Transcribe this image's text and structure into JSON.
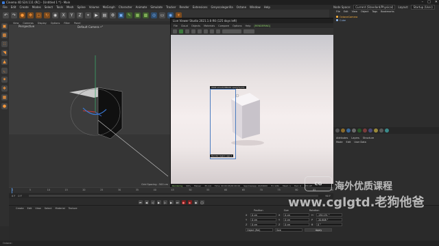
{
  "window": {
    "title": "Cinema 4D S24.111 (RC) - [Untitled 1 *] - Main",
    "min_icon": "minimize-icon",
    "max_icon": "maximize-icon",
    "close_icon": "close-icon"
  },
  "menubar": [
    "File",
    "Edit",
    "Create",
    "Modes",
    "Select",
    "Tools",
    "Mesh",
    "Spline",
    "Volume",
    "MoGraph",
    "Character",
    "Animate",
    "Simulate",
    "Tracker",
    "Render",
    "Extensions",
    "Greyscalegorilla",
    "Octane",
    "Window",
    "Help"
  ],
  "rightbar": {
    "node_space_label": "Node Space:",
    "node_space_value": "Current (Standard/Physical)",
    "layout_label": "Layout:",
    "layout_value": "Startup (User)"
  },
  "viewport": {
    "menu": [
      "View",
      "Cameras",
      "Display",
      "Options",
      "Filter",
      "Panel"
    ],
    "name": "Perspective",
    "camera": "Default Camera •°",
    "grid_spacing": "Grid Spacing : 500 cm"
  },
  "ipr": {
    "title": "Live Viewer Studio 2021.1.6-R6 (125 days left)",
    "menu": [
      "File",
      "Cloud",
      "Objects",
      "Materials",
      "Compare",
      "Options",
      "Help",
      "[RENDERING]"
    ],
    "region_label": "WKM smart/CBRAW spent/%(23)",
    "region_render": "Render region spp:1",
    "status": [
      "Rendering",
      "99%",
      "Ms/sec",
      "35.1/4",
      "Time: 00:00:05/00:00:06",
      "Spp/maxspp: 20/16000",
      "Tri: 0/6k",
      "Mesh: 1",
      "Hair: 0",
      "RTX:off"
    ]
  },
  "object_manager": {
    "tabs": [
      "File",
      "Edit",
      "View",
      "Object",
      "Tags",
      "Bookmarks"
    ],
    "objects": [
      {
        "name": "OctaneCamera",
        "color": "#ffb23a"
      },
      {
        "name": "Cube",
        "color": "#8fb6e8"
      }
    ]
  },
  "attributes": {
    "tabs": [
      "Attributes",
      "Layers",
      "Structure"
    ],
    "menu": [
      "Mode",
      "Edit",
      "User Data"
    ]
  },
  "timeline": {
    "ticks": [
      "0",
      "5",
      "10",
      "15",
      "20",
      "25",
      "30",
      "35",
      "40",
      "45",
      "50",
      "55",
      "60",
      "65",
      "70",
      "75",
      "80",
      "85",
      "90"
    ],
    "start": "0 F",
    "end": "90 F",
    "current": "0 F"
  },
  "material_manager": {
    "menu": [
      "Create",
      "Edit",
      "View",
      "Select",
      "Material",
      "Texture"
    ]
  },
  "coordinates": {
    "headers": [
      "Position",
      "Size",
      "Rotation"
    ],
    "rows": [
      {
        "axis": "X",
        "pos": "0 cm",
        "size": "0 cm",
        "rot_label": "H",
        "rot": "-130.151 °"
      },
      {
        "axis": "Y",
        "pos": "0 cm",
        "size": "0 cm",
        "rot_label": "P",
        "rot": "-20.608 °"
      },
      {
        "axis": "Z",
        "pos": "0 cm",
        "size": "0 cm",
        "rot_label": "B",
        "rot": "0 °"
      }
    ],
    "mode": "Object (Rel)",
    "size_mode": "Size",
    "apply": "Apply"
  },
  "watermark": {
    "logo": "CG",
    "line1": "海外优质课程",
    "line2": "www.cglgtd.老狗他爸"
  },
  "status_bar": "Octane: "
}
